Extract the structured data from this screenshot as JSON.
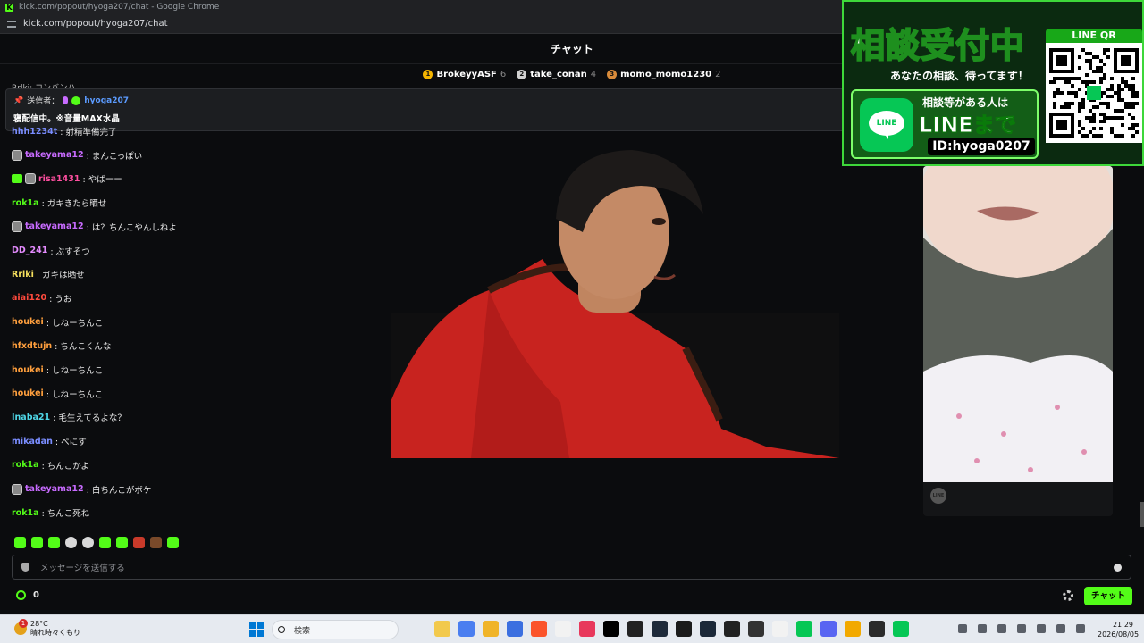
{
  "browser": {
    "window_title": "kick.com/popout/hyoga207/chat - Google Chrome",
    "url": "kick.com/popout/hyoga207/chat",
    "favicon_letter": "K"
  },
  "chat": {
    "header": "チャット",
    "leaderboard": [
      {
        "user": "BrokeyyASF",
        "count": "6",
        "rank": "1",
        "color": "#f4b400"
      },
      {
        "user": "take_conan",
        "count": "4",
        "rank": "2",
        "color": "#d0d0d0"
      },
      {
        "user": "momo_momo1230",
        "count": "2",
        "rank": "3",
        "color": "#d98b3a"
      }
    ],
    "partial_top_line": "Rrlki: コンバンハ",
    "pinned": {
      "label": "送信者：",
      "user": "hyoga207",
      "text": "寝配信中。※音量MAX水晶"
    },
    "messages": [
      {
        "user": "hhh1234t",
        "text": "射精準備完了",
        "color": "#7a8dff",
        "avatar": false,
        "badge": false
      },
      {
        "user": "takeyama12",
        "text": "まんこっぽい",
        "color": "#c86bff",
        "avatar": true,
        "badge": false
      },
      {
        "user": "risa1431",
        "text": "やばーー",
        "color": "#ff4fa0",
        "avatar": true,
        "badge": true
      },
      {
        "user": "rok1a",
        "text": "ガキきたら晒せ",
        "color": "#53fc18",
        "avatar": false,
        "badge": false
      },
      {
        "user": "takeyama12",
        "text": "は？ちんこやんしねよ",
        "color": "#c86bff",
        "avatar": true,
        "badge": false
      },
      {
        "user": "DD_241",
        "text": "ぶすそつ",
        "color": "#e58cff",
        "avatar": false,
        "badge": false
      },
      {
        "user": "Rrlki",
        "text": "ガキは晒せ",
        "color": "#f6e05e",
        "avatar": false,
        "badge": false
      },
      {
        "user": "aiai120",
        "text": "うお",
        "color": "#ff4a3d",
        "avatar": false,
        "badge": false
      },
      {
        "user": "houkei",
        "text": "しねーちんこ",
        "color": "#ff9f3d",
        "avatar": false,
        "badge": false
      },
      {
        "user": "hfxdtujn",
        "text": "ちんこくんな",
        "color": "#ff9f3d",
        "avatar": false,
        "badge": false
      },
      {
        "user": "houkei",
        "text": "しねーちんこ",
        "color": "#ff9f3d",
        "avatar": false,
        "badge": false
      },
      {
        "user": "houkei",
        "text": "しねーちんこ",
        "color": "#ff9f3d",
        "avatar": false,
        "badge": false
      },
      {
        "user": "Inaba21",
        "text": "毛生えてるよな？",
        "color": "#4fd8e8",
        "avatar": false,
        "badge": false
      },
      {
        "user": "mikadan",
        "text": "べにす",
        "color": "#7a8dff",
        "avatar": false,
        "badge": false
      },
      {
        "user": "rok1a",
        "text": "ちんこかよ",
        "color": "#53fc18",
        "avatar": false,
        "badge": false
      },
      {
        "user": "takeyama12",
        "text": "白ちんこがボケ",
        "color": "#c86bff",
        "avatar": true,
        "badge": false
      },
      {
        "user": "rok1a",
        "text": "ちんこ死ね",
        "color": "#53fc18",
        "avatar": false,
        "badge": false
      }
    ],
    "input_placeholder": "メッセージを送信する",
    "points": "0",
    "send_button": "チャット"
  },
  "banner": {
    "title": "相談受付中",
    "subtitle": "あなたの相談、待ってます！",
    "line1": "相談等がある人は",
    "line2": "LINEまで",
    "line_id": "ID:hyoga0207",
    "qr_label": "LINE QR",
    "logo_text": "LINE"
  },
  "stream_card": {
    "logo_text": "LINE"
  },
  "taskbar": {
    "temp": "28°C",
    "weather_text": "晴れ時々くもり",
    "notification_count": "1",
    "search_label": "検索",
    "time": "21:29",
    "date": "2026/08/05",
    "app_colors": [
      "#f2c94c",
      "#4a7ef0",
      "#f0b429",
      "#3b6fe0",
      "#fb542b",
      "#f2f2f2",
      "#e8385c",
      "#000000",
      "#222222",
      "#1e2a3a",
      "#1b1b1b",
      "#1b2838",
      "#222222",
      "#333333",
      "#f2f2f2",
      "#06c755",
      "#5865f2",
      "#f2a900",
      "#2b2b2b",
      "#06c755"
    ]
  }
}
